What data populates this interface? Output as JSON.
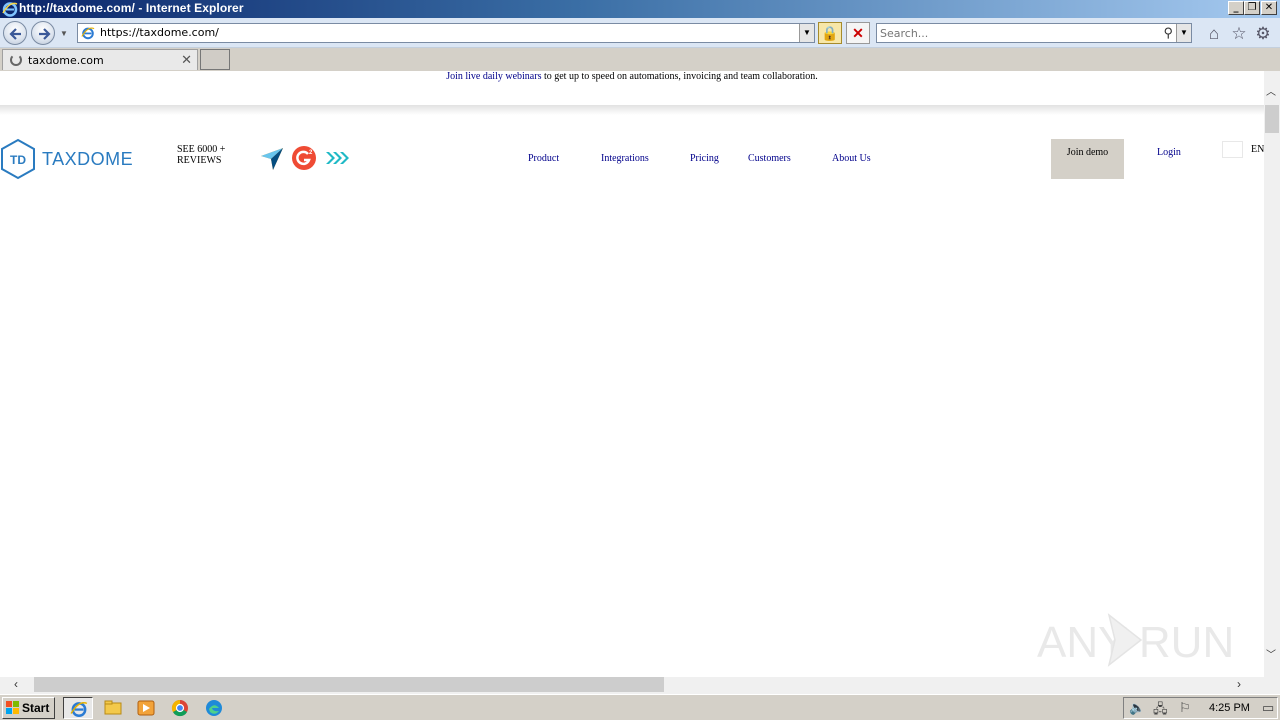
{
  "window": {
    "title": "http://taxdome.com/ - Internet Explorer",
    "minimize": "_",
    "restore": "❐",
    "close": "✕"
  },
  "addressbar": {
    "url": "https://taxdome.com/",
    "search_placeholder": "Search..."
  },
  "tabs": [
    {
      "label": "taxdome.com"
    }
  ],
  "page": {
    "banner_link": "Join live daily webinars",
    "banner_text": " to get up to speed on automations, invoicing and team collaboration.",
    "logo_text": "TAXDOME",
    "logo_mark": "TD",
    "reviews_line1": "SEE 6000 +",
    "reviews_line2": "REVIEWS",
    "nav": {
      "product": "Product",
      "integrations": "Integrations",
      "pricing": "Pricing",
      "customers": "Customers",
      "about": "About Us"
    },
    "join_demo": "Join demo",
    "login": "Login",
    "language": "EN"
  },
  "watermark": "ANY RUN",
  "taskbar": {
    "start": "Start",
    "clock": "4:25 PM"
  },
  "colors": {
    "brand_blue": "#2a7bc0",
    "link_blue": "#00008b",
    "g2_red": "#ef4b34"
  }
}
